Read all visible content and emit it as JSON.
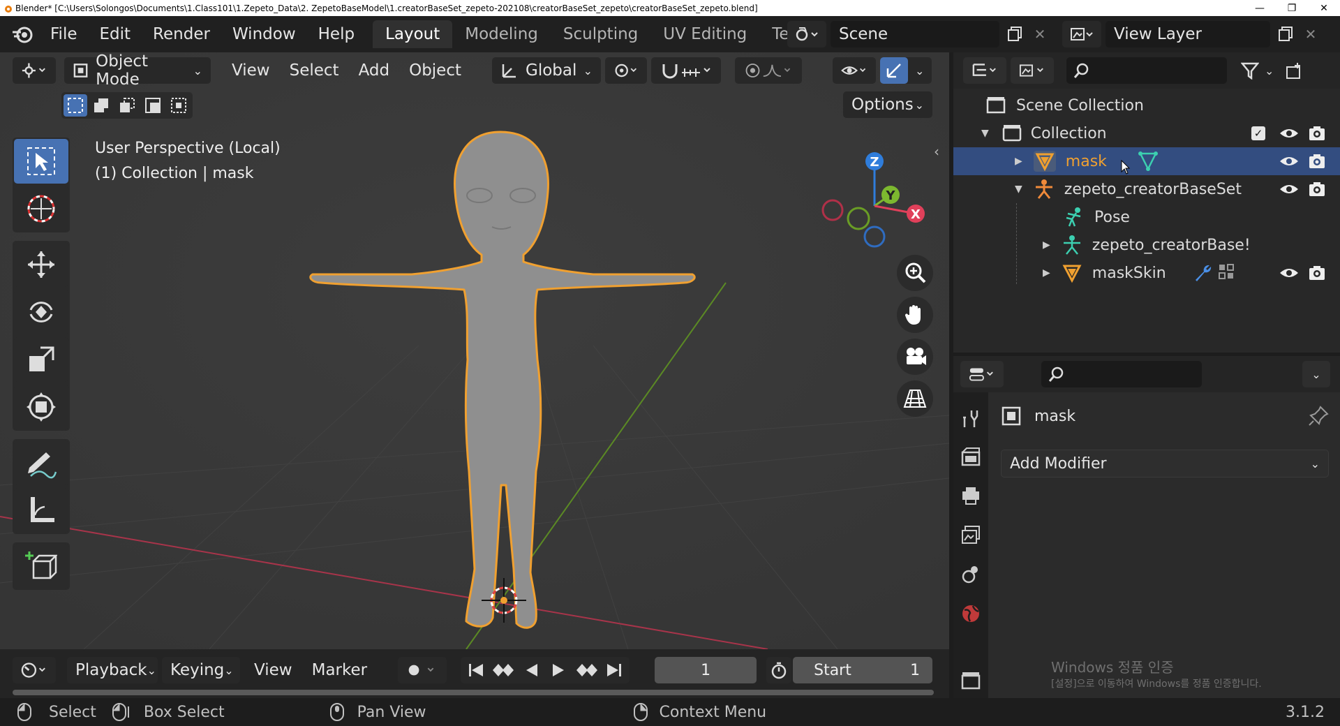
{
  "titlebar": {
    "text": "Blender* [C:\\Users\\Solongos\\Documents\\1.Class101\\1.Zepeto_Data\\2. ZepetoBaseModel\\1.creatorBaseSet_zepeto-202108\\creatorBaseSet_zepeto\\creatorBaseSet_zepeto.blend]"
  },
  "menu": [
    "File",
    "Edit",
    "Render",
    "Window",
    "Help"
  ],
  "tabs": [
    "Layout",
    "Modeling",
    "Sculpting",
    "UV Editing",
    "Te"
  ],
  "scene": {
    "label": "Scene"
  },
  "viewlayer": {
    "label": "View Layer"
  },
  "viewport": {
    "mode": "Object Mode",
    "menus": [
      "View",
      "Select",
      "Add",
      "Object"
    ],
    "orientation": "Global",
    "options": "Options",
    "info_line1": "User Perspective (Local)",
    "info_line2": "(1) Collection | mask",
    "gizmo": {
      "z": "Z",
      "y": "Y",
      "x": "X"
    }
  },
  "outliner": {
    "scene_collection": "Scene Collection",
    "collection": "Collection",
    "items": [
      "mask",
      "zepeto_creatorBaseSet",
      "Pose",
      "zepeto_creatorBase!",
      "maskSkin"
    ]
  },
  "properties": {
    "object_name": "mask",
    "add_modifier": "Add Modifier",
    "watermark1": "Windows 정품 인증",
    "watermark2": "[설정]으로 이동하여 Windows를 정품 인증합니다."
  },
  "timeline": {
    "menus": [
      "Playback",
      "Keying",
      "View",
      "Marker"
    ],
    "frame": "1",
    "start_label": "Start",
    "start_value": "1"
  },
  "status": {
    "select": "Select",
    "box_select": "Box Select",
    "pan_view": "Pan View",
    "context_menu": "Context Menu",
    "version": "3.1.2"
  },
  "colors": {
    "accent": "#4772b3",
    "selection": "#f0a030",
    "selected_row": "#334d80",
    "axis_x": "#e0405a",
    "axis_y": "#7cb82f",
    "axis_z": "#2f7ddb"
  }
}
